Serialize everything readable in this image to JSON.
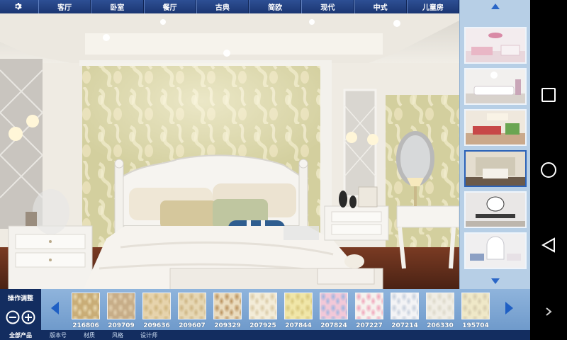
{
  "tabs": [
    "客厅",
    "卧室",
    "餐厅",
    "古典",
    "简欧",
    "现代",
    "中式",
    "儿童房"
  ],
  "thumbnails": [
    {
      "name": "thumb-kids-room",
      "wall": "#f3ecee",
      "accent": "#d98aa6",
      "selected": false
    },
    {
      "name": "thumb-living-room-white",
      "wall": "#f2f0ee",
      "accent": "#c9a6b8",
      "selected": false
    },
    {
      "name": "thumb-living-room-colorful",
      "wall": "#efe8dd",
      "accent": "#c74848",
      "selected": false
    },
    {
      "name": "thumb-bedroom-classic",
      "wall": "#e4ddcf",
      "accent": "#6b5a4a",
      "selected": true
    },
    {
      "name": "thumb-dining-room",
      "wall": "#e9e7e6",
      "accent": "#3a3a3a",
      "selected": false
    },
    {
      "name": "thumb-lounge-white",
      "wall": "#f0eff0",
      "accent": "#8ca0c4",
      "selected": false
    }
  ],
  "bottom": {
    "ops_label": "操作调整",
    "all_products": "全部产品",
    "filters": [
      "版本号",
      "材质",
      "风格",
      "设计师"
    ]
  },
  "swatches": [
    {
      "code": "216806",
      "color": "#c9ad77",
      "pattern": "#e8d8b0"
    },
    {
      "code": "209709",
      "color": "#c7ad88",
      "pattern": "#e2cfae"
    },
    {
      "code": "209636",
      "color": "#e6d3ac",
      "pattern": "#cfb67f"
    },
    {
      "code": "209607",
      "color": "#e6d7b4",
      "pattern": "#cdb482"
    },
    {
      "code": "209329",
      "color": "#eadbbd",
      "pattern": "#b9915e"
    },
    {
      "code": "207925",
      "color": "#f3ecd8",
      "pattern": "#d9c9a5"
    },
    {
      "code": "207844",
      "color": "#f0e6a8",
      "pattern": "#d8c77e"
    },
    {
      "code": "207824",
      "color": "#f2c8d8",
      "pattern": "#9fb6e0"
    },
    {
      "code": "207227",
      "color": "#f6f2ee",
      "pattern": "#f1a2b8"
    },
    {
      "code": "207214",
      "color": "#f3f3f5",
      "pattern": "#c6cfdc"
    },
    {
      "code": "206330",
      "color": "#f0ede4",
      "pattern": "#dcd8c9"
    },
    {
      "code": "195704",
      "color": "#efe8c8",
      "pattern": "#d6ccae"
    }
  ],
  "colors": {
    "accent": "#1b3672",
    "strip": "#7fa6d3",
    "thumbcol": "#b7cfe6"
  }
}
